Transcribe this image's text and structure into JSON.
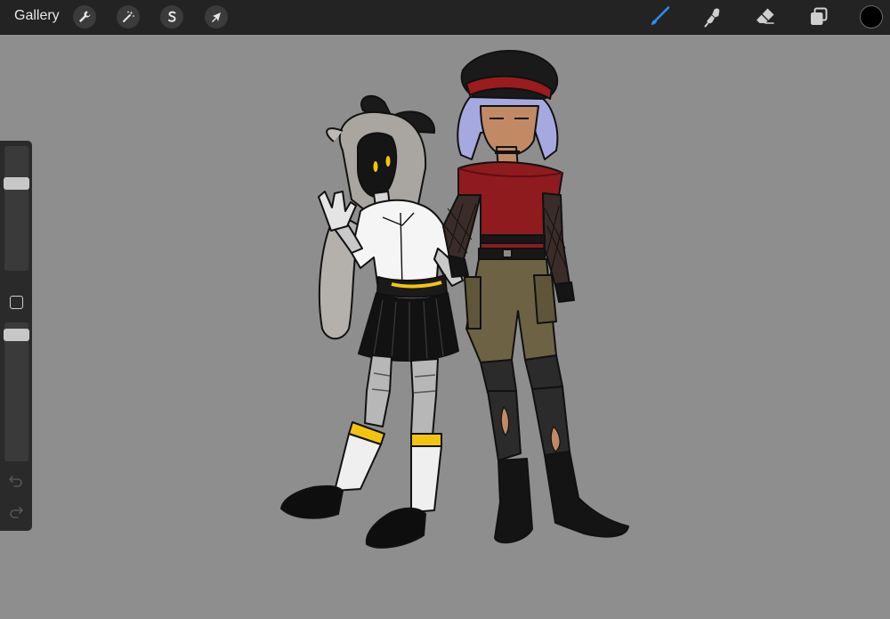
{
  "topbar": {
    "gallery_label": "Gallery",
    "actions_icon": "wrench-icon",
    "adjustments_icon": "magic-wand-icon",
    "selection_icon": "selection-s-icon",
    "transform_icon": "arrow-cursor-icon",
    "brush_icon": "brush-icon",
    "smudge_icon": "smudge-icon",
    "eraser_icon": "eraser-icon",
    "layers_icon": "layers-icon",
    "active_color": "#000000",
    "brush_active_color": "#2e8cf0"
  },
  "sidebar": {
    "brush_size_level": 0.72,
    "opacity_level": 0.95,
    "undo_icon": "undo-icon",
    "redo_icon": "redo-icon",
    "modify_icon": "square-modify-icon"
  },
  "canvas": {
    "background_color": "#8e8e8e",
    "content": "illustration"
  }
}
